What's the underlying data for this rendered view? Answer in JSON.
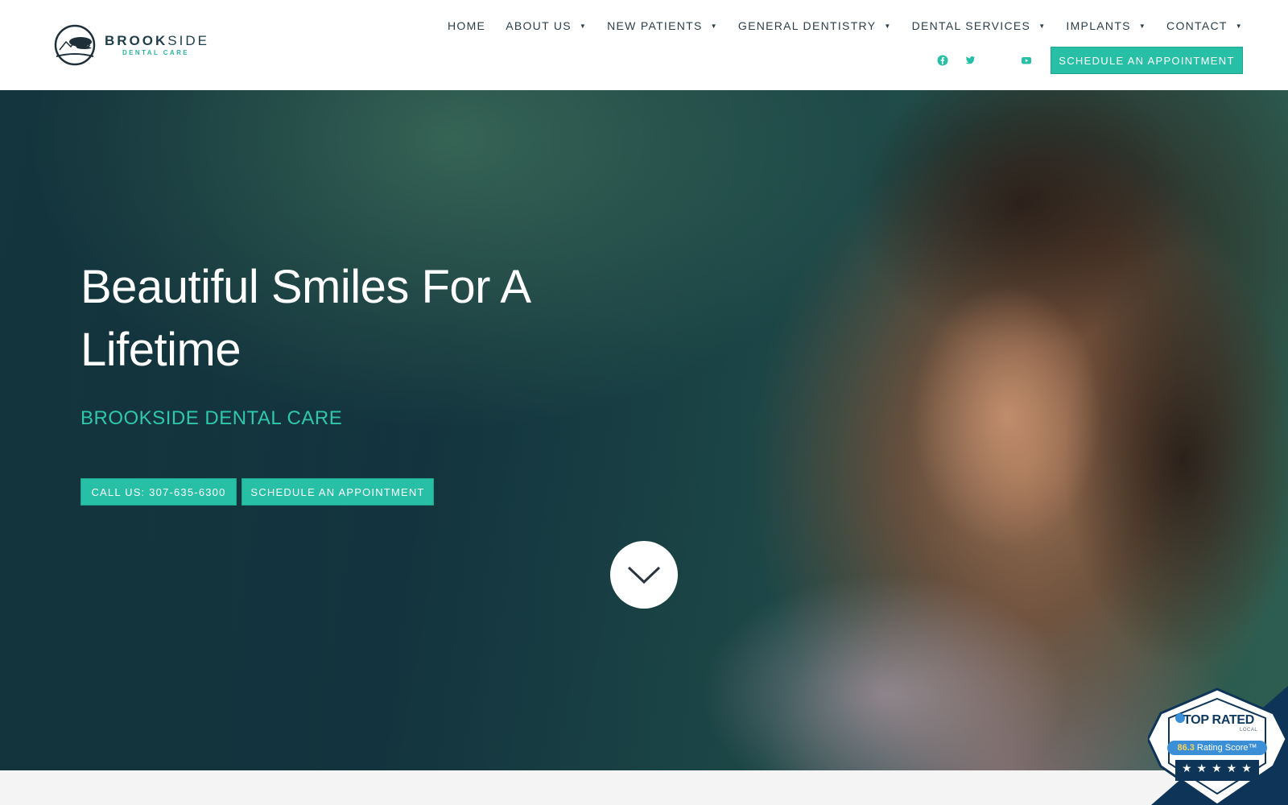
{
  "brand": {
    "name_bold": "BROOK",
    "name_light": "SIDE",
    "tagline": "DENTAL CARE"
  },
  "nav": {
    "items": [
      {
        "label": "HOME",
        "has_dropdown": false
      },
      {
        "label": "ABOUT US",
        "has_dropdown": true
      },
      {
        "label": "NEW PATIENTS",
        "has_dropdown": true
      },
      {
        "label": "GENERAL DENTISTRY",
        "has_dropdown": true
      },
      {
        "label": "DENTAL SERVICES",
        "has_dropdown": true
      },
      {
        "label": "IMPLANTS",
        "has_dropdown": true
      },
      {
        "label": "CONTACT",
        "has_dropdown": true
      }
    ],
    "dropdown_glyph": "▼"
  },
  "social": [
    "facebook-icon",
    "twitter-icon",
    "youtube-icon"
  ],
  "header": {
    "schedule_label": "SCHEDULE AN APPOINTMENT"
  },
  "hero": {
    "title": "Beautiful Smiles For A Lifetime",
    "subtitle": "BROOKSIDE DENTAL CARE",
    "call_label": "CALL US: 307-635-6300",
    "schedule_label": "SCHEDULE AN APPOINTMENT"
  },
  "badge": {
    "title": "TOP RATED",
    "small": "LOCAL",
    "score": "86.3",
    "score_label": "Rating Score™",
    "stars": "★★★★★"
  },
  "colors": {
    "accent": "#27c0a6",
    "header_text": "#2c3e4a",
    "badge_navy": "#0e3558"
  }
}
